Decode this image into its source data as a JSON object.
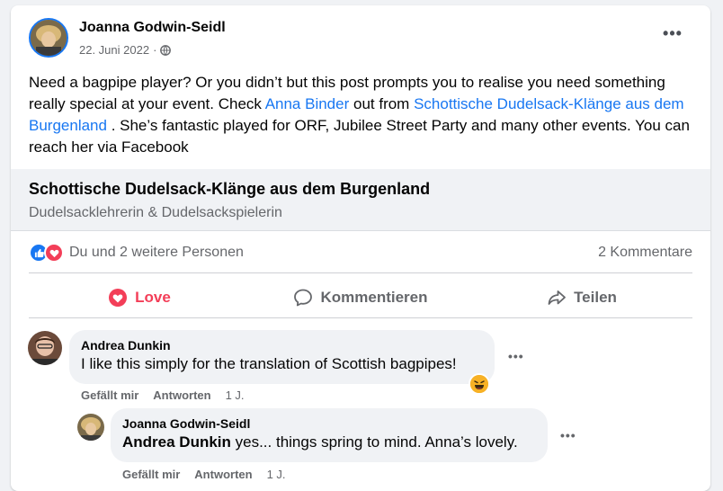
{
  "post": {
    "author": "Joanna Godwin-Seidl",
    "date": "22. Juni 2022",
    "dot": "·",
    "text_1": "Need a bagpipe player? Or you didn’t but this post prompts you to realise you need something really special at your event. Check ",
    "mention_1": "Anna Binder",
    "text_2": " out from ",
    "mention_2": "Schottische Dudelsack-Klänge aus dem Burgenland",
    "text_3": " . She’s fantastic played for ORF, Jubilee Street Party and many other events. You can reach her via Facebook",
    "more": "•••"
  },
  "preview": {
    "title": "Schottische Dudelsack-Klänge aus dem Burgenland",
    "subtitle": "Dudelsacklehrerin & Dudelsackspielerin"
  },
  "reactions": {
    "text": "Du und 2 weitere Personen",
    "comments": "2 Kommentare"
  },
  "actions": {
    "love": "Love",
    "comment": "Kommentieren",
    "share": "Teilen"
  },
  "comments": [
    {
      "name": "Andrea Dunkin",
      "text": "I like this simply for the translation of Scottish bagpipes!",
      "like": "Gefällt mir",
      "reply": "Antworten",
      "time": "1 J.",
      "more": "•••"
    },
    {
      "name": "Joanna Godwin-Seidl",
      "mention": "Andrea Dunkin",
      "text": " yes... things spring to mind. Anna’s lovely.",
      "like": "Gefällt mir",
      "reply": "Antworten",
      "time": "1 J.",
      "more": "•••"
    }
  ],
  "colors": {
    "accent": "#1877f2",
    "love": "#f33e58",
    "secondary_text": "#65676b",
    "bubble": "#f0f2f5"
  }
}
